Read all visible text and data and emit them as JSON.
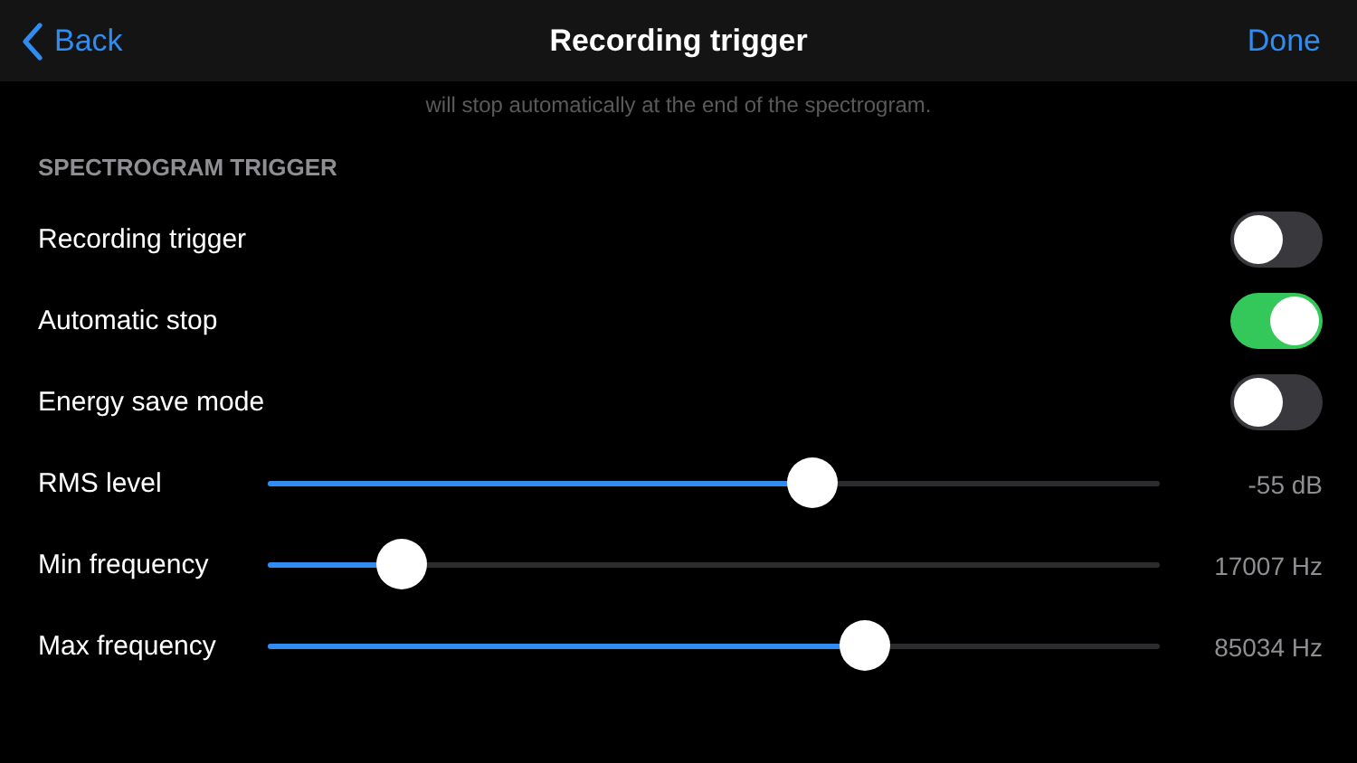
{
  "nav": {
    "back": "Back",
    "title": "Recording trigger",
    "done": "Done"
  },
  "footer_note": "will stop automatically at the end of the spectrogram.",
  "section": {
    "header": "SPECTROGRAM TRIGGER",
    "rows": [
      {
        "kind": "toggle",
        "label": "Recording trigger",
        "on": false
      },
      {
        "kind": "toggle",
        "label": "Automatic stop",
        "on": true
      },
      {
        "kind": "toggle",
        "label": "Energy save mode",
        "on": false
      },
      {
        "kind": "slider",
        "label": "RMS level",
        "level": 0.61,
        "reading": "-55 dB"
      },
      {
        "kind": "slider",
        "label": "Min frequency",
        "level": 0.15,
        "reading": "17007 Hz"
      },
      {
        "kind": "slider",
        "label": "Max frequency",
        "level": 0.67,
        "reading": "85034 Hz"
      }
    ]
  }
}
